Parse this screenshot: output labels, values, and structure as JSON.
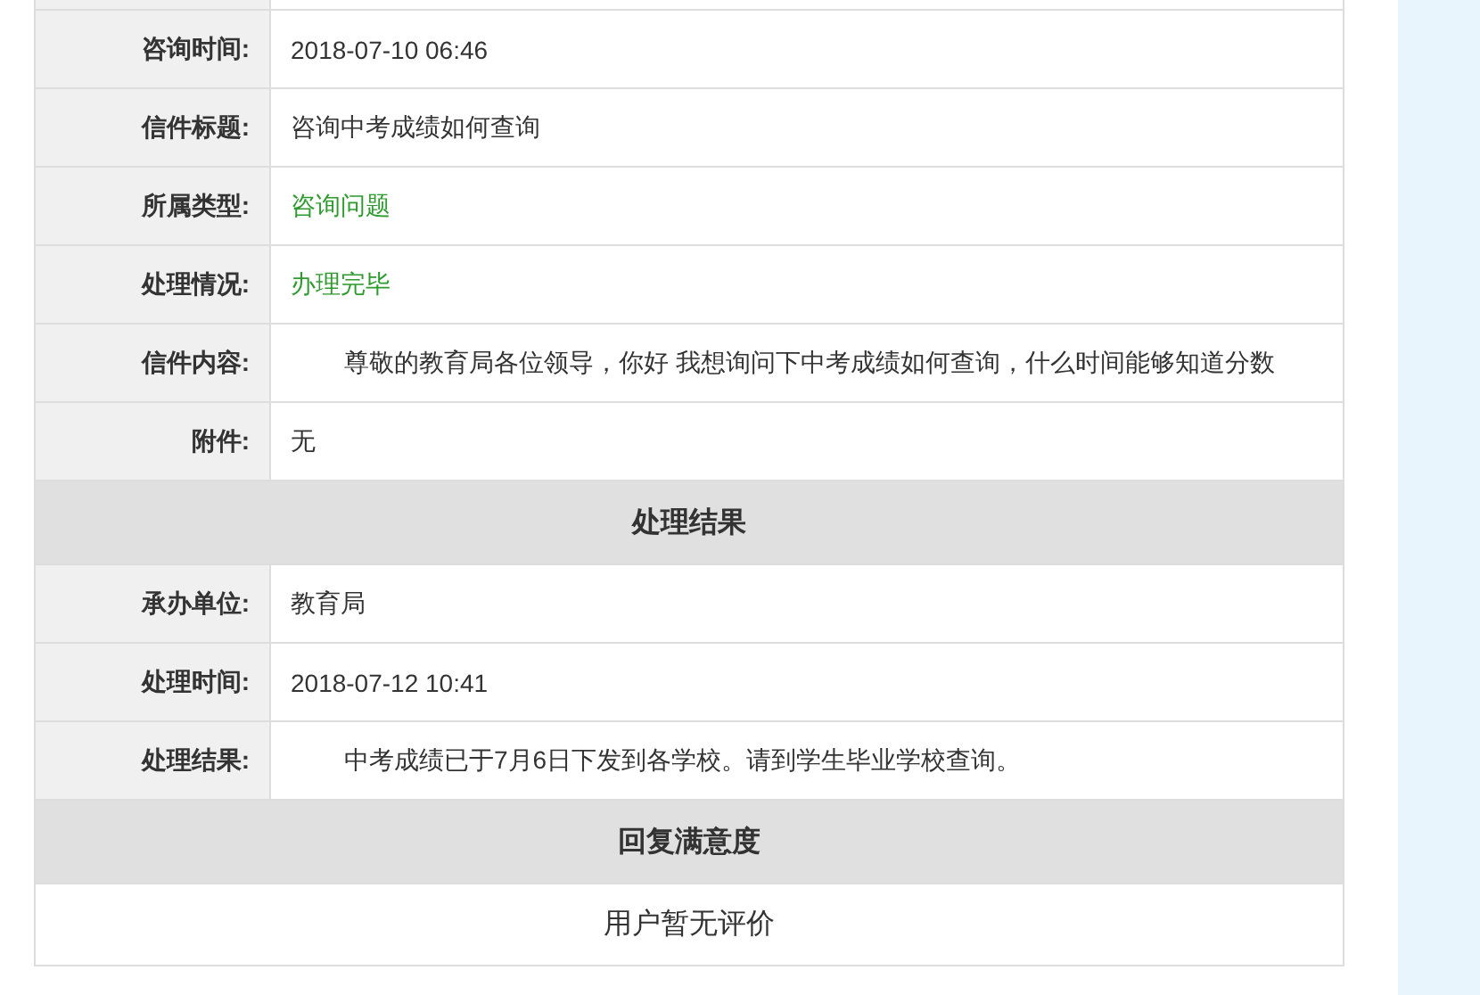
{
  "rows": [
    {
      "kind": "row",
      "label": "咨询时间:",
      "value": "2018-07-10 06:46"
    },
    {
      "kind": "row",
      "label": "信件标题:",
      "value": "咨询中考成绩如何查询"
    },
    {
      "kind": "row",
      "label": "所属类型:",
      "value": "咨询问题",
      "color": "#2e9b2e"
    },
    {
      "kind": "row",
      "label": "处理情况:",
      "value": "办理完毕",
      "color": "#2e9b2e"
    },
    {
      "kind": "row",
      "label": "信件内容:",
      "value": "尊敬的教育局各位领导，你好 我想询问下中考成绩如何查询，什么时间能够知道分数",
      "indent": true
    },
    {
      "kind": "row",
      "label": "附件:",
      "value": "无"
    },
    {
      "kind": "heading",
      "text": "处理结果"
    },
    {
      "kind": "row",
      "label": "承办单位:",
      "value": "教育局"
    },
    {
      "kind": "row",
      "label": "处理时间:",
      "value": "2018-07-12 10:41"
    },
    {
      "kind": "row",
      "label": "处理结果:",
      "value": "中考成绩已于7月6日下发到各学校。请到学生毕业学校查询。",
      "indent": true
    },
    {
      "kind": "heading",
      "text": "回复满意度"
    },
    {
      "kind": "note",
      "text": "用户暂无评价"
    }
  ]
}
